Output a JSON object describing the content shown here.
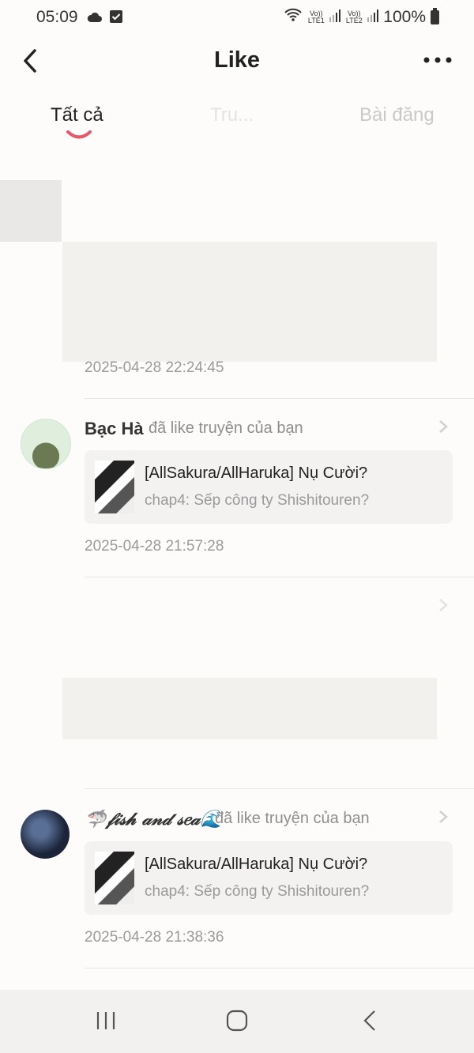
{
  "status": {
    "time": "05:09",
    "sim1": "Vo)) LTE1",
    "sim2": "Vo)) LTE2",
    "battery": "100%"
  },
  "header": {
    "title": "Like"
  },
  "tabs": [
    {
      "label": "Tất cả",
      "active": true
    },
    {
      "label": "Tru...",
      "active": false
    },
    {
      "label": "Bài đăng",
      "active": false
    }
  ],
  "items": [
    {
      "timestamp": "2025-04-28 22:24:45"
    },
    {
      "user": "Bạc Hà",
      "action": "đã like truyện của bạn",
      "story_title": "[AllSakura/AllHaruka] Nụ Cười?",
      "chapter": "chap4: Sếp công ty Shishitouren?",
      "timestamp": "2025-04-28 21:57:28"
    },
    {
      "user": "🦈𝒻𝒾𝓈𝒽 𝒶𝓃𝒹 𝓈𝑒𝒶🌊",
      "action": "đã like truyện của bạn",
      "story_title": "[AllSakura/AllHaruka] Nụ Cười?",
      "chapter": "chap4: Sếp công ty Shishitouren?",
      "timestamp": "2025-04-28 21:38:36"
    }
  ]
}
